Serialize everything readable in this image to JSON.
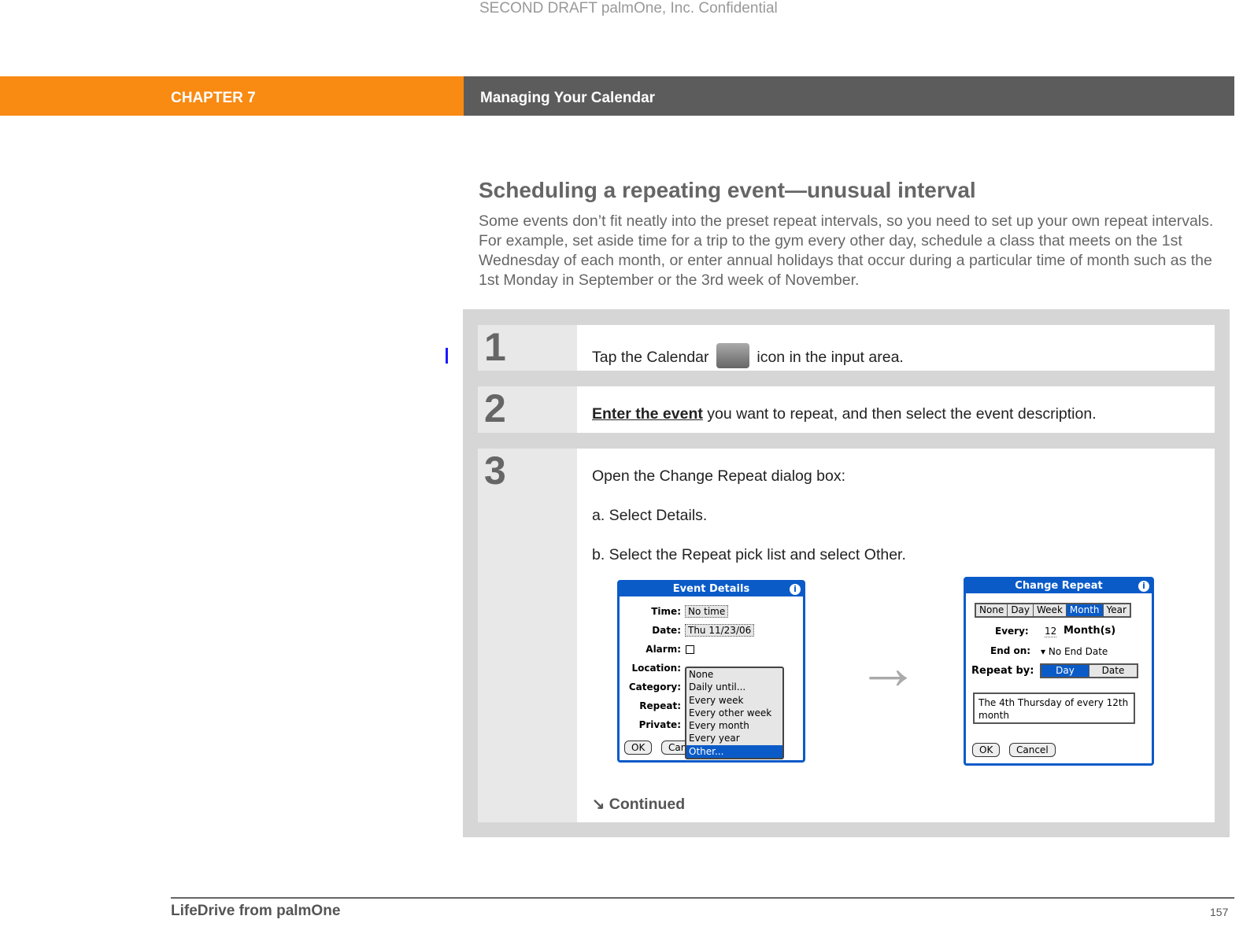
{
  "watermark": "SECOND DRAFT palmOne, Inc.  Confidential",
  "header": {
    "chapter": "CHAPTER 7",
    "title": "Managing Your Calendar"
  },
  "section": {
    "title": "Scheduling a repeating event—unusual interval",
    "intro": "Some events don’t fit neatly into the preset repeat intervals, so you need to set up your own repeat intervals. For example, set aside time for a trip to the gym every other day, schedule a class that meets on the 1st Wednesday of each month, or enter annual holidays that occur during a particular time of month such as the 1st Monday in September or the 3rd week of November."
  },
  "steps": [
    {
      "num": "1",
      "pre": "Tap the Calendar",
      "post": "icon in the input area."
    },
    {
      "num": "2",
      "link": "Enter the event",
      "post": " you want to repeat, and then select the event description."
    },
    {
      "num": "3",
      "text": "Open the Change Repeat dialog box:",
      "a": "a.  Select Details.",
      "b": "b.  Select the Repeat pick list and select Other.",
      "continued": "Continued"
    }
  ],
  "event_details": {
    "title": "Event Details",
    "labels": [
      "Time:",
      "Date:",
      "Alarm:",
      "Location:",
      "Category:",
      "Repeat:",
      "Private:"
    ],
    "time": "No time",
    "date": "Thu 11/23/06",
    "ok": "OK",
    "cancel": "Can",
    "picklist": [
      "None",
      "Daily until...",
      "Every week",
      "Every other week",
      "Every month",
      "Every year",
      "Other..."
    ],
    "selected": "Other..."
  },
  "change_repeat": {
    "title": "Change Repeat",
    "tabs": [
      "None",
      "Day",
      "Week",
      "Month",
      "Year"
    ],
    "active_tab": "Month",
    "every_label": "Every:",
    "every_value": "12",
    "every_unit": "Month(s)",
    "end_label": "End on:",
    "end_value": "No End Date",
    "repeat_by_label": "Repeat by:",
    "repeat_by": [
      "Day",
      "Date"
    ],
    "repeat_by_active": "Day",
    "summary": "The 4th Thursday of every 12th month",
    "ok": "OK",
    "cancel": "Cancel"
  },
  "footer": {
    "book": "LifeDrive from palmOne",
    "page": "157"
  },
  "colors": {
    "accent": "#f98a12",
    "header_gray": "#5c5c5c",
    "palm_blue": "#0a5bc8"
  }
}
